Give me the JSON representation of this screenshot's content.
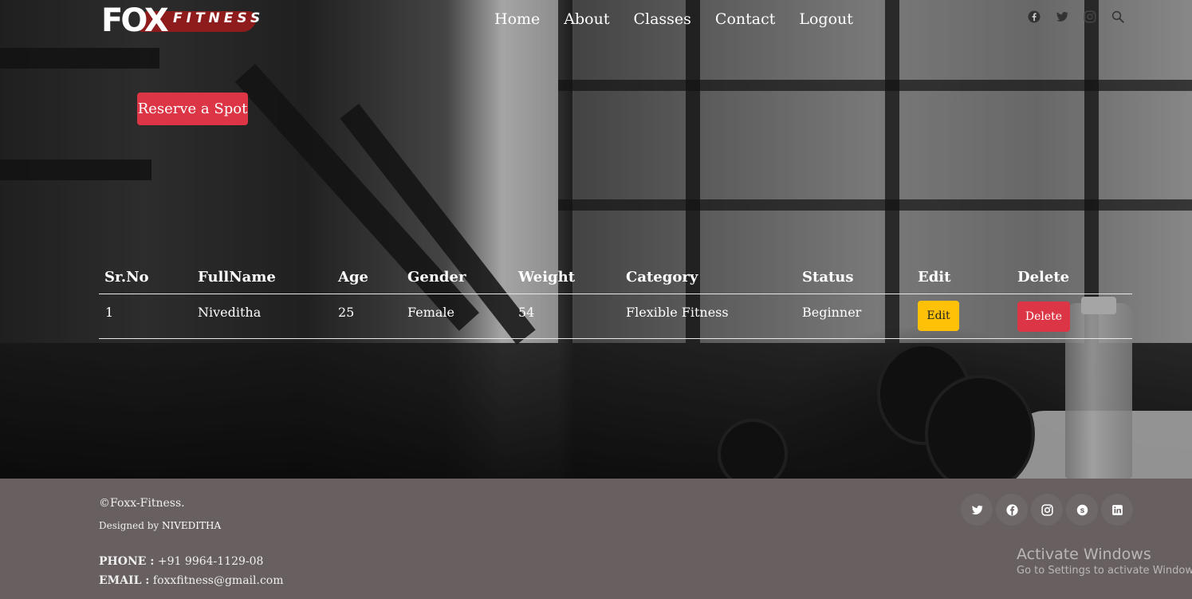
{
  "brand": {
    "logo_text": "FOX",
    "logo_sub": "FITNESS"
  },
  "nav": {
    "items": [
      "Home",
      "About",
      "Classes",
      "Contact",
      "Logout"
    ]
  },
  "header_social": [
    "facebook-icon",
    "twitter-icon",
    "instagram-icon",
    "search-icon"
  ],
  "reserve_button": "Reserve a Spot",
  "table": {
    "headers": [
      "Sr.No",
      "FullName",
      "Age",
      "Gender",
      "Weight",
      "Category",
      "Status",
      "Edit",
      "Delete"
    ],
    "rows": [
      {
        "sr": "1",
        "name": "Niveditha",
        "age": "25",
        "gender": "Female",
        "weight": "54",
        "category": "Flexible Fitness",
        "status": "Beginner",
        "edit": "Edit",
        "delete": "Delete"
      }
    ]
  },
  "footer": {
    "copyright": "©Foxx-Fitness.",
    "designed_prefix": "Designed by",
    "designed_name": "NIVEDITHA",
    "phone_label": "PHONE :",
    "phone": "+91 9964-1129-08",
    "email_label": "EMAIL :",
    "email": "foxxfitness@gmail.com",
    "social": [
      "twitter-icon",
      "facebook-icon",
      "instagram-icon",
      "skype-icon",
      "linkedin-icon"
    ]
  },
  "watermark": {
    "title": "Activate Windows",
    "subtitle": "Go to Settings to activate Windows."
  },
  "colors": {
    "accent_red": "#dc3545",
    "edit_yellow": "#ffc107",
    "footer_bg": "#675f60"
  }
}
